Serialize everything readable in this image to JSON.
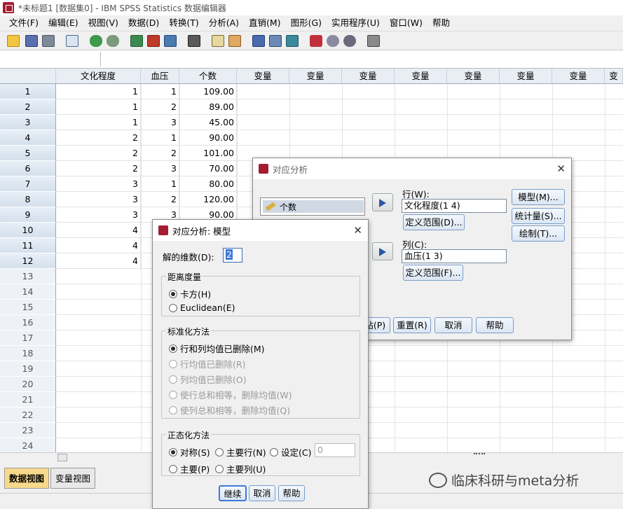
{
  "window": {
    "title": "*未标题1 [数据集0] - IBM SPSS Statistics 数据编辑器"
  },
  "menu": [
    "文件(F)",
    "编辑(E)",
    "视图(V)",
    "数据(D)",
    "转换(T)",
    "分析(A)",
    "直销(M)",
    "图形(G)",
    "实用程序(U)",
    "窗口(W)",
    "帮助"
  ],
  "toolbar_icons": [
    "open-icon",
    "save-icon",
    "print-icon",
    "dialog-recall-icon",
    "undo-icon",
    "redo-icon",
    "goto-case-icon",
    "goto-variable-icon",
    "variables-icon",
    "find-icon",
    "insert-cases-icon",
    "insert-variable-icon",
    "split-file-icon",
    "weight-cases-icon",
    "select-cases-icon",
    "value-labels-icon",
    "use-sets-icon",
    "show-all-icon",
    "spelling-icon"
  ],
  "grid": {
    "columns": [
      "文化程度",
      "血压",
      "个数",
      "变量",
      "变量",
      "变量",
      "变量",
      "变量",
      "变量",
      "变量",
      "变"
    ],
    "row_numbers": [
      "1",
      "2",
      "3",
      "4",
      "5",
      "6",
      "7",
      "8",
      "9",
      "10",
      "11",
      "12",
      "13",
      "14",
      "15",
      "16",
      "17",
      "18",
      "19",
      "20",
      "21",
      "22",
      "23",
      "24"
    ],
    "rows": [
      [
        "1",
        "1",
        "109.00"
      ],
      [
        "1",
        "2",
        "89.00"
      ],
      [
        "1",
        "3",
        "45.00"
      ],
      [
        "2",
        "1",
        "90.00"
      ],
      [
        "2",
        "2",
        "101.00"
      ],
      [
        "2",
        "3",
        "70.00"
      ],
      [
        "3",
        "1",
        "80.00"
      ],
      [
        "3",
        "2",
        "120.00"
      ],
      [
        "3",
        "3",
        "90.00"
      ],
      [
        "4",
        "",
        ""
      ],
      [
        "4",
        "",
        ""
      ],
      [
        "4",
        "",
        ""
      ]
    ]
  },
  "tabs": {
    "data_view": "数据视图",
    "variable_view": "变量视图"
  },
  "corr_dialog": {
    "title": "对应分析",
    "source_item": "个数",
    "row_label": "行(W):",
    "row_value": "文化程度(1 4)",
    "row_range_btn": "定义范围(D)...",
    "col_label": "列(C):",
    "col_value": "血压(1 3)",
    "col_range_btn": "定义范围(F)...",
    "model_btn": "模型(M)...",
    "stats_btn": "统计量(S)...",
    "plots_btn": "绘制(T)...",
    "paste_btn": "粘贴(P)",
    "reset_btn": "重置(R)",
    "cancel_btn": "取消",
    "help_btn": "帮助"
  },
  "model_dialog": {
    "title": "对应分析: 模型",
    "dimension_label": "解的维数(D):",
    "dimension_value": "2",
    "distance_group": "距离度量",
    "distance_options": [
      "卡方(H)",
      "Euclidean(E)"
    ],
    "standardization_group": "标准化方法",
    "standardization_options": [
      "行和列均值已删除(M)",
      "行均值已删除(R)",
      "列均值已删除(O)",
      "使行总和相等，删除均值(W)",
      "使列总和相等，删除均值(Q)"
    ],
    "normalization_group": "正态化方法",
    "normalization_options": [
      "对称(S)",
      "主要行(N)",
      "设定(C)",
      "主要(P)",
      "主要列(U)"
    ],
    "custom_value": "0",
    "continue_btn": "继续",
    "cancel_btn": "取消",
    "help_btn": "帮助"
  },
  "watermark": "临床科研与meta分析",
  "colors": {
    "accent": "#a51c30",
    "header_bg": "#e9eef5",
    "button_border": "#7a9cc8"
  }
}
